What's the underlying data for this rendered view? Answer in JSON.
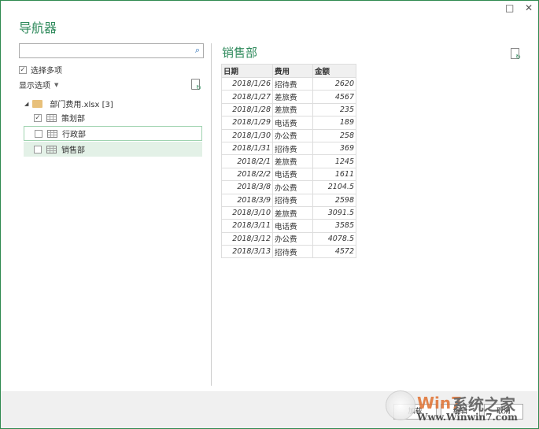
{
  "window": {
    "title": "导航器",
    "maximize_icon": "□",
    "close_icon": "✕"
  },
  "left": {
    "search": {
      "value": "",
      "placeholder": ""
    },
    "multi_select": {
      "label": "选择多项",
      "checked": true
    },
    "display_options": "显示选项",
    "file": {
      "name": "部门费用.xlsx [3]"
    },
    "items": [
      {
        "label": "策划部",
        "checked": true
      },
      {
        "label": "行政部",
        "checked": false
      },
      {
        "label": "销售部",
        "checked": false
      }
    ]
  },
  "right": {
    "title": "销售部",
    "columns": [
      "日期",
      "费用",
      "金额"
    ],
    "rows": [
      [
        "2018/1/26",
        "招待费",
        "2620"
      ],
      [
        "2018/1/27",
        "差旅费",
        "4567"
      ],
      [
        "2018/1/28",
        "差旅费",
        "235"
      ],
      [
        "2018/1/29",
        "电话费",
        "189"
      ],
      [
        "2018/1/30",
        "办公费",
        "258"
      ],
      [
        "2018/1/31",
        "招待费",
        "369"
      ],
      [
        "2018/2/1",
        "差旅费",
        "1245"
      ],
      [
        "2018/2/2",
        "电话费",
        "1611"
      ],
      [
        "2018/3/8",
        "办公费",
        "2104.5"
      ],
      [
        "2018/3/9",
        "招待费",
        "2598"
      ],
      [
        "2018/3/10",
        "差旅费",
        "3091.5"
      ],
      [
        "2018/3/11",
        "电话费",
        "3585"
      ],
      [
        "2018/3/12",
        "办公费",
        "4078.5"
      ],
      [
        "2018/3/13",
        "招待费",
        "4572"
      ]
    ]
  },
  "footer": {
    "load": "加载",
    "edit": "编辑",
    "cancel": "取消"
  },
  "watermark": {
    "brand": "Win7",
    "cn": "系统之家",
    "url": "Www.Winwin7.com"
  }
}
